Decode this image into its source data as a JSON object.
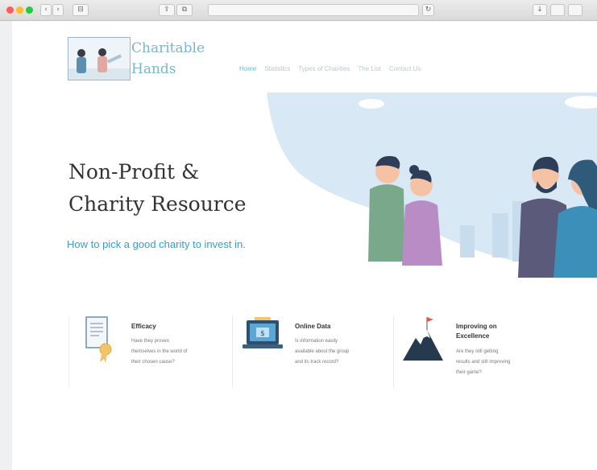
{
  "browser": {
    "url": "",
    "buttons": {
      "back": "‹",
      "forward": "›",
      "sidebar": "⊟",
      "share": "⇪",
      "tabs": "⧉",
      "reload": "↻",
      "download": "↓"
    }
  },
  "site": {
    "logo_line1": "Charitable",
    "logo_line2": "Hands"
  },
  "nav": {
    "items": [
      "Home",
      "Statistics",
      "Types of Charities",
      "The List",
      "Contact Us"
    ],
    "active_index": 0
  },
  "hero": {
    "title_line1": "Non-Profit &",
    "title_line2": "Charity Resource",
    "subtitle": "How to pick a good charity to invest in."
  },
  "features": [
    {
      "title": "Efficacy",
      "desc_lines": [
        "Have they proven",
        "themselves in the world of",
        "their chosen cause?"
      ],
      "icon": "certificate-icon"
    },
    {
      "title": "Online Data",
      "desc_lines": [
        "Is information easily",
        "available about the group",
        "and its track record?"
      ],
      "icon": "laptop-money-icon"
    },
    {
      "title_lines": [
        "Improving on",
        "Excellence"
      ],
      "desc_lines": [
        "Are they still getting",
        "results and still improving",
        "their game?"
      ],
      "icon": "mountain-flag-icon"
    }
  ],
  "colors": {
    "accent": "#2ba3cf",
    "nav_active": "#5ec0d8",
    "logo": "#7db5c8",
    "sky": "#d8e9f5"
  }
}
